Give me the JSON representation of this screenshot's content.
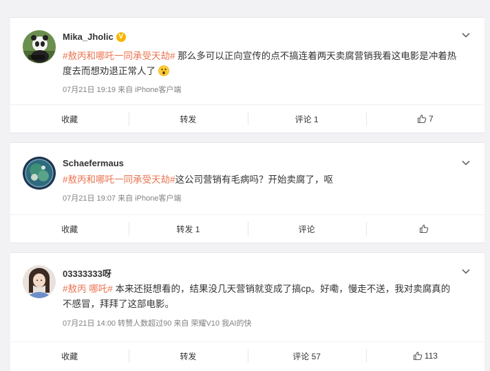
{
  "posts": [
    {
      "username": "Mika_Jholic",
      "verified": true,
      "tag": "#敖丙和哪吒一同承受天劫#",
      "text": " 那么多可以正向宣传的点不搞连着两天卖腐营销我看这电影是冲着热度去而想劝退正常人了",
      "emoji": "😮",
      "meta": "07月21日 19:19  来自 iPhone客户端",
      "actions": {
        "collect": "收藏",
        "repost": "转发",
        "comment": "评论 1",
        "like": "7"
      }
    },
    {
      "username": "Schaefermaus",
      "verified": false,
      "tag": "#敖丙和哪吒一同承受天劫#",
      "text": "这公司营销有毛病吗？开始卖腐了，呕",
      "meta": "07月21日 19:07  来自 iPhone客户端",
      "actions": {
        "collect": "收藏",
        "repost": "转发 1",
        "comment": "评论",
        "like": ""
      }
    },
    {
      "username": "03333333呀",
      "verified": false,
      "tag": "#敖丙 哪吒#",
      "text": " 本来还挺想看的，结果没几天营销就变成了搞cp。好嘞，慢走不送，我对卖腐真的不感冒，拜拜了这部电影。",
      "meta": "07月21日 14:00 转赞人数超过90  来自 荣耀V10 我AI的快",
      "actions": {
        "collect": "收藏",
        "repost": "转发",
        "comment": "评论 57",
        "like": "113"
      }
    }
  ],
  "colors": {
    "tag": "#eb7350",
    "badge": "#f8b500",
    "background": "#f2f2f5"
  },
  "icons": [
    "chevron-down-icon",
    "thumbs-up-icon",
    "verified-badge-icon",
    "surprised-emoji-icon"
  ]
}
